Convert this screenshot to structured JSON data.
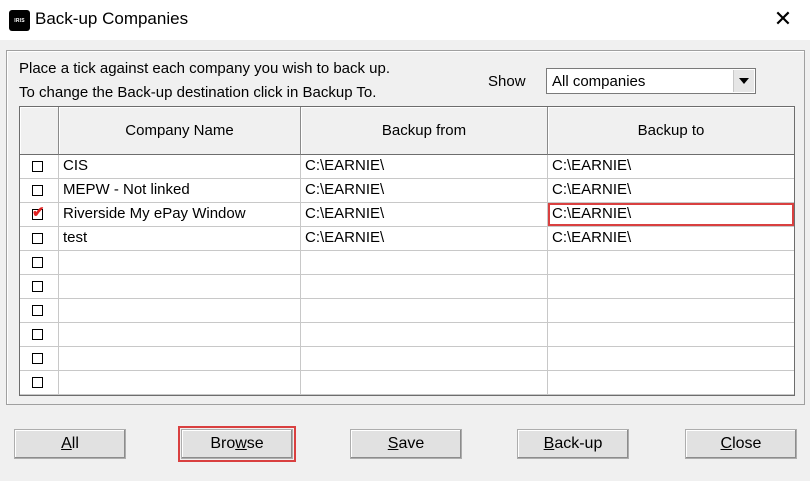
{
  "window": {
    "app_icon_text": "IRIS",
    "title": "Back-up Companies",
    "close_glyph": "✕"
  },
  "instructions": {
    "line1": "Place a tick against each company you wish to back up.",
    "line2": "To change the Back-up destination click in Backup To."
  },
  "show": {
    "label": "Show",
    "selected": "All companies"
  },
  "table": {
    "columns": [
      "",
      "Company Name",
      "Backup from",
      "Backup to"
    ],
    "rows": [
      {
        "checked": false,
        "company": "CIS",
        "from": "C:\\EARNIE\\",
        "to": "C:\\EARNIE\\"
      },
      {
        "checked": false,
        "company": "MEPW - Not linked",
        "from": "C:\\EARNIE\\",
        "to": "C:\\EARNIE\\"
      },
      {
        "checked": true,
        "company": "Riverside My ePay Window",
        "from": "C:\\EARNIE\\",
        "to": "C:\\EARNIE\\"
      },
      {
        "checked": false,
        "company": "test",
        "from": "C:\\EARNIE\\",
        "to": "C:\\EARNIE\\"
      },
      {
        "checked": false,
        "company": "",
        "from": "",
        "to": ""
      },
      {
        "checked": false,
        "company": "",
        "from": "",
        "to": ""
      },
      {
        "checked": false,
        "company": "",
        "from": "",
        "to": ""
      },
      {
        "checked": false,
        "company": "",
        "from": "",
        "to": ""
      },
      {
        "checked": false,
        "company": "",
        "from": "",
        "to": ""
      },
      {
        "checked": false,
        "company": "",
        "from": "",
        "to": ""
      }
    ],
    "highlight_color": "#d94040"
  },
  "buttons": {
    "all": {
      "pre": "",
      "key": "A",
      "post": "ll"
    },
    "browse": {
      "pre": "Bro",
      "key": "w",
      "post": "se"
    },
    "save": {
      "pre": "",
      "key": "S",
      "post": "ave"
    },
    "backup": {
      "pre": "",
      "key": "B",
      "post": "ack-up"
    },
    "close": {
      "pre": "",
      "key": "C",
      "post": "lose"
    }
  }
}
